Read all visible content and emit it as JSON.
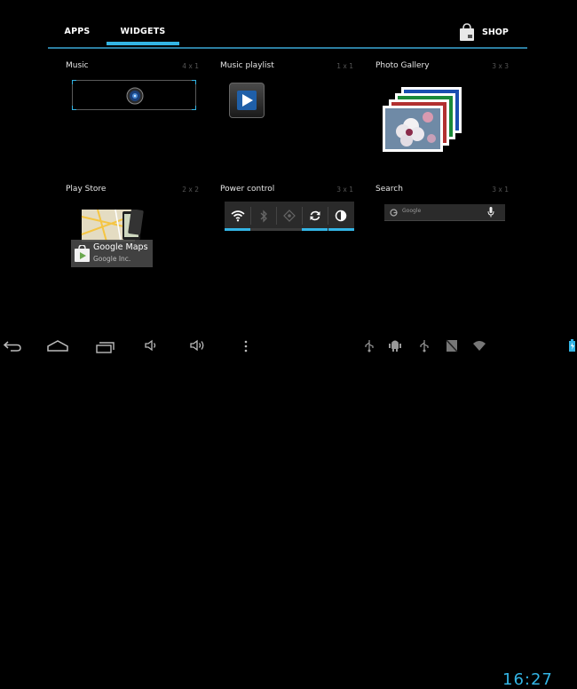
{
  "tabs": {
    "apps": "APPS",
    "widgets": "WIDGETS",
    "selected": "WIDGETS"
  },
  "shop": {
    "label": "SHOP"
  },
  "widgets": [
    {
      "name": "Music",
      "size": "4 x 1"
    },
    {
      "name": "Music playlist",
      "size": "1 x 1"
    },
    {
      "name": "Photo Gallery",
      "size": "3 x 3"
    },
    {
      "name": "Play Store",
      "size": "2 x 2"
    },
    {
      "name": "Power control",
      "size": "3 x 1"
    },
    {
      "name": "Search",
      "size": "3 x 1"
    }
  ],
  "play_store_preview": {
    "app_name": "Google Maps",
    "developer": "Google Inc."
  },
  "search_preview": {
    "placeholder": "Google"
  },
  "power_control": {
    "toggles": [
      {
        "icon": "wifi-icon",
        "on": true
      },
      {
        "icon": "bluetooth-icon",
        "on": false
      },
      {
        "icon": "gps-icon",
        "on": false
      },
      {
        "icon": "sync-icon",
        "on": true
      },
      {
        "icon": "brightness-icon",
        "on": true
      }
    ]
  },
  "status_bar": {
    "time": "16:27"
  },
  "colors": {
    "accent": "#33b5e5",
    "background": "#000000"
  }
}
